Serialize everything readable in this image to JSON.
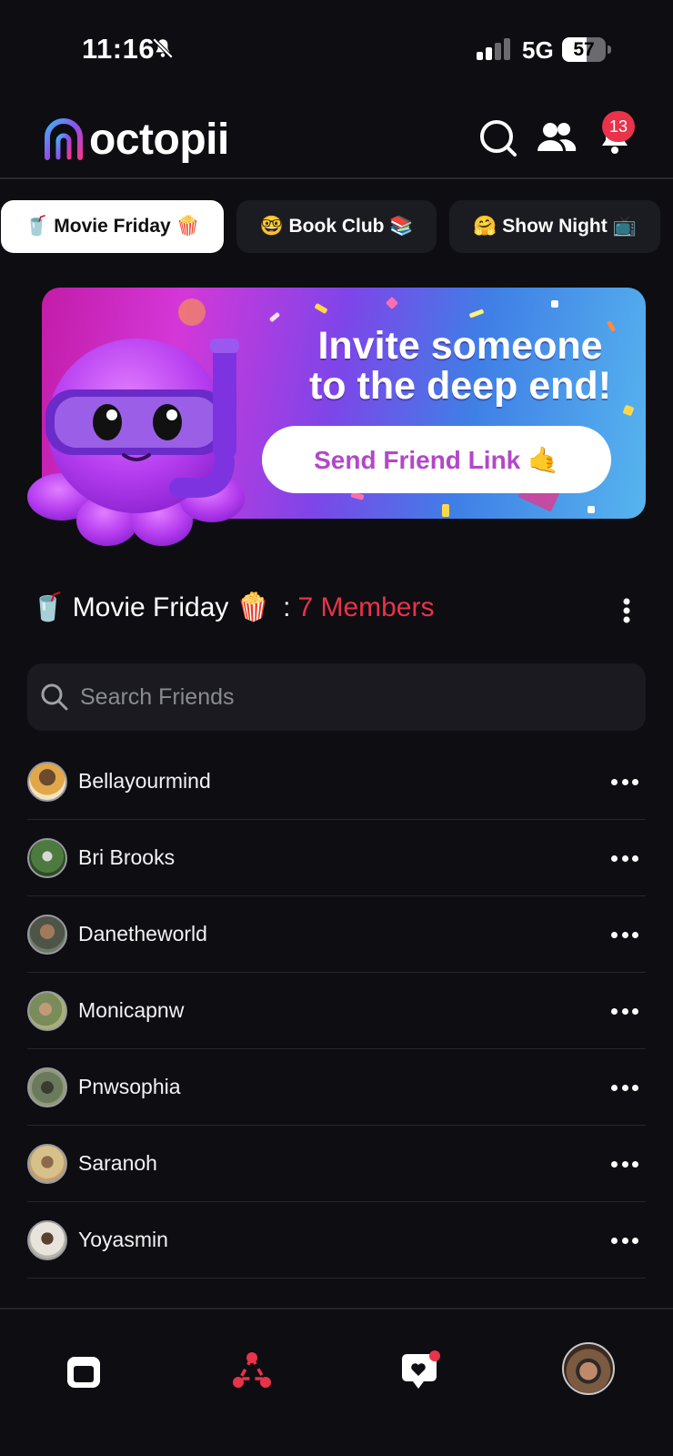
{
  "status_bar": {
    "time": "11:16",
    "network": "5G",
    "battery_level": "57",
    "battery_fraction": 0.57
  },
  "header": {
    "logo_text": "octopii",
    "notification_count": "13",
    "icons": [
      "search-icon",
      "friends-icon",
      "bell-icon"
    ]
  },
  "tabs": [
    {
      "label": "🥤 Movie Friday 🍿",
      "active": true
    },
    {
      "label": "🤓 Book Club 📚",
      "active": false
    },
    {
      "label": "🤗 Show Night 📺",
      "active": false
    }
  ],
  "banner": {
    "title_line1": "Invite someone",
    "title_line2": "to the deep end!",
    "button_label": "Send Friend Link 🤙"
  },
  "group": {
    "name": "🥤 Movie Friday 🍿",
    "separator": ":",
    "members": "7 Members"
  },
  "search": {
    "placeholder": "Search Friends",
    "value": ""
  },
  "friends": [
    {
      "name": "Bellayourmind"
    },
    {
      "name": "Bri Brooks"
    },
    {
      "name": "Danetheworld"
    },
    {
      "name": "Monicapnw"
    },
    {
      "name": "Pnwsophia"
    },
    {
      "name": "Saranoh"
    },
    {
      "name": "Yoyasmin"
    }
  ],
  "bottom_nav": {
    "items": [
      "feed-icon",
      "groups-icon",
      "chat-heart-icon",
      "profile-avatar"
    ],
    "active_index": 1
  },
  "colors": {
    "background": "#0d0d12",
    "accent": "#e8334a",
    "button_text": "#b347c9"
  }
}
